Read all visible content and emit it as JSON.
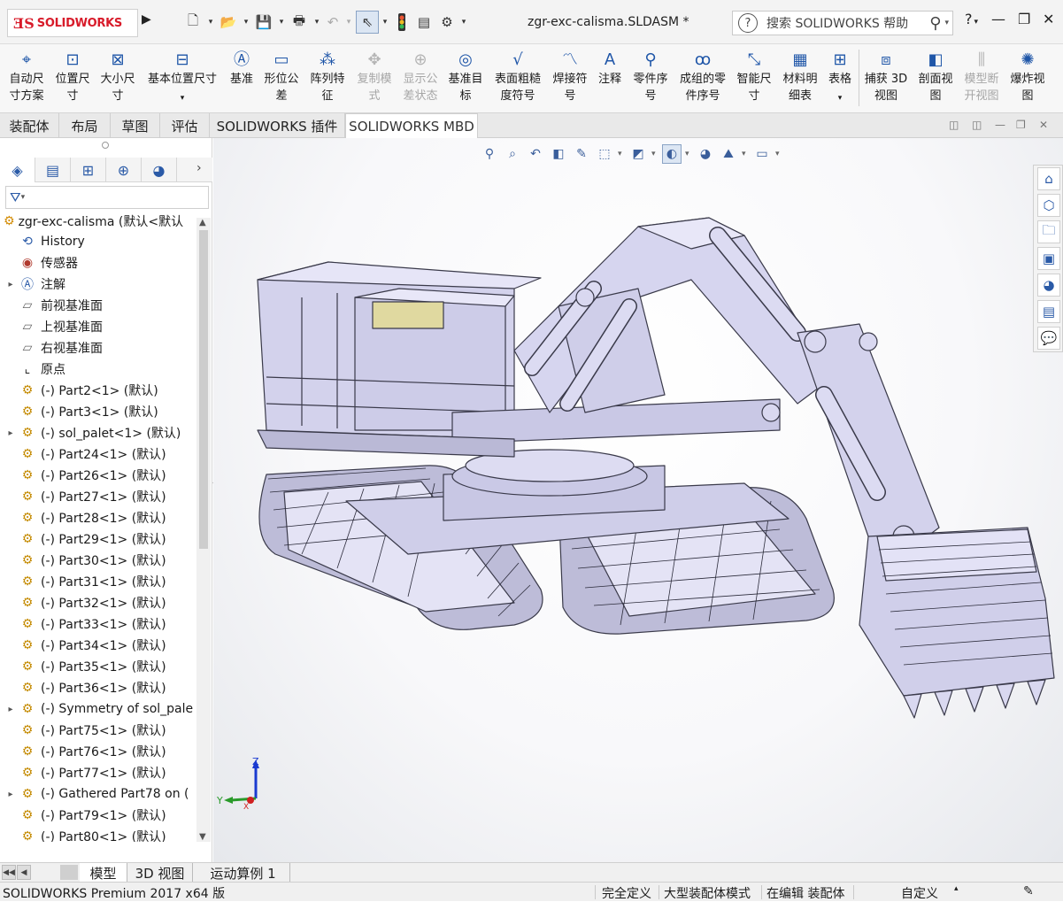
{
  "app": {
    "logo": "SOLIDWORKS",
    "doc_title": "zgr-exc-calisma.SLDASM *",
    "search_placeholder": "搜索 SOLIDWORKS 帮助",
    "help_label": "?",
    "window_buttons": [
      "—",
      "❐",
      "✕"
    ]
  },
  "quick_access": [
    "new",
    "open",
    "save",
    "print",
    "undo",
    "select",
    "rebuild",
    "file-props",
    "options"
  ],
  "ribbon": [
    {
      "l1": "自动尺",
      "l2": "寸方案",
      "icon": "auto-dim-icon",
      "disabled": false
    },
    {
      "l1": "位置尺",
      "l2": "寸",
      "icon": "location-dim-icon",
      "disabled": false
    },
    {
      "l1": "大小尺",
      "l2": "寸",
      "icon": "size-dim-icon",
      "disabled": false
    },
    {
      "l1": "基本位置尺寸",
      "l2": "",
      "icon": "basic-location-dim-icon",
      "disabled": false
    },
    {
      "l1": "基准",
      "l2": "",
      "icon": "datum-icon",
      "disabled": false
    },
    {
      "l1": "形位公",
      "l2": "差",
      "icon": "geometric-tolerance-icon",
      "disabled": false
    },
    {
      "l1": "阵列特",
      "l2": "征",
      "icon": "pattern-feature-icon",
      "disabled": false
    },
    {
      "l1": "复制模",
      "l2": "式",
      "icon": "copy-scheme-icon",
      "disabled": true
    },
    {
      "l1": "显示公",
      "l2": "差状态",
      "icon": "tolerance-status-icon",
      "disabled": true
    },
    {
      "l1": "基准目",
      "l2": "标",
      "icon": "datum-target-icon",
      "disabled": false
    },
    {
      "l1": "表面粗糙",
      "l2": "度符号",
      "icon": "surface-finish-icon",
      "disabled": false
    },
    {
      "l1": "焊接符",
      "l2": "号",
      "icon": "weld-symbol-icon",
      "disabled": false
    },
    {
      "l1": "注释",
      "l2": "",
      "icon": "note-icon",
      "disabled": false
    },
    {
      "l1": "零件序",
      "l2": "号",
      "icon": "balloon-icon",
      "disabled": false
    },
    {
      "l1": "成组的零",
      "l2": "件序号",
      "icon": "stacked-balloon-icon",
      "disabled": false
    },
    {
      "l1": "智能尺",
      "l2": "寸",
      "icon": "smart-dim-icon",
      "disabled": false
    },
    {
      "l1": "材料明",
      "l2": "细表",
      "icon": "bom-icon",
      "disabled": false
    },
    {
      "l1": "表格",
      "l2": "",
      "icon": "table-icon",
      "disabled": false
    },
    {
      "l1": "捕获 3D",
      "l2": "视图",
      "icon": "capture-3d-view-icon",
      "disabled": false
    },
    {
      "l1": "剖面视",
      "l2": "图",
      "icon": "section-view-icon",
      "disabled": false
    },
    {
      "l1": "模型断",
      "l2": "开视图",
      "icon": "model-break-icon",
      "disabled": true
    },
    {
      "l1": "爆炸视",
      "l2": "图",
      "icon": "exploded-view-icon",
      "disabled": false
    }
  ],
  "tabs": [
    "装配体",
    "布局",
    "草图",
    "评估",
    "SOLIDWORKS 插件",
    "SOLIDWORKS MBD"
  ],
  "active_tab": "SOLIDWORKS MBD",
  "tree": {
    "root": "zgr-exc-calisma  (默认<默认",
    "items": [
      {
        "label": "History",
        "icon": "history",
        "exp": ""
      },
      {
        "label": "传感器",
        "icon": "sensor",
        "exp": ""
      },
      {
        "label": "注解",
        "icon": "annotation",
        "exp": "▸"
      },
      {
        "label": "前视基准面",
        "icon": "plane",
        "exp": ""
      },
      {
        "label": "上视基准面",
        "icon": "plane",
        "exp": ""
      },
      {
        "label": "右视基准面",
        "icon": "plane",
        "exp": ""
      },
      {
        "label": "原点",
        "icon": "origin",
        "exp": ""
      },
      {
        "label": "(-) Part2<1> (默认)",
        "icon": "part",
        "exp": ""
      },
      {
        "label": "(-) Part3<1> (默认)",
        "icon": "part",
        "exp": ""
      },
      {
        "label": "(-) sol_palet<1> (默认)",
        "icon": "part",
        "exp": "▸"
      },
      {
        "label": "(-) Part24<1> (默认)",
        "icon": "part",
        "exp": ""
      },
      {
        "label": "(-) Part26<1> (默认)",
        "icon": "part",
        "exp": ""
      },
      {
        "label": "(-) Part27<1> (默认)",
        "icon": "part",
        "exp": ""
      },
      {
        "label": "(-) Part28<1> (默认)",
        "icon": "part",
        "exp": ""
      },
      {
        "label": "(-) Part29<1> (默认)",
        "icon": "part",
        "exp": ""
      },
      {
        "label": "(-) Part30<1> (默认)",
        "icon": "part",
        "exp": ""
      },
      {
        "label": "(-) Part31<1> (默认)",
        "icon": "part",
        "exp": ""
      },
      {
        "label": "(-) Part32<1> (默认)",
        "icon": "part",
        "exp": ""
      },
      {
        "label": "(-) Part33<1> (默认)",
        "icon": "part",
        "exp": ""
      },
      {
        "label": "(-) Part34<1> (默认)",
        "icon": "part",
        "exp": ""
      },
      {
        "label": "(-) Part35<1> (默认)",
        "icon": "part",
        "exp": ""
      },
      {
        "label": "(-) Part36<1> (默认)",
        "icon": "part",
        "exp": ""
      },
      {
        "label": "(-) Symmetry of sol_pale",
        "icon": "part",
        "exp": "▸"
      },
      {
        "label": "(-) Part75<1> (默认)",
        "icon": "part",
        "exp": ""
      },
      {
        "label": "(-) Part76<1> (默认)",
        "icon": "part",
        "exp": ""
      },
      {
        "label": "(-) Part77<1> (默认)",
        "icon": "part",
        "exp": ""
      },
      {
        "label": "(-) Gathered Part78 on (",
        "icon": "part",
        "exp": "▸"
      },
      {
        "label": "(-) Part79<1> (默认)",
        "icon": "part",
        "exp": ""
      },
      {
        "label": "(-) Part80<1> (默认)",
        "icon": "part",
        "exp": ""
      }
    ]
  },
  "bottom_tabs": [
    "模型",
    "3D 视图",
    "运动算例 1"
  ],
  "active_bottom_tab": "模型",
  "status": {
    "product": "SOLIDWORKS Premium 2017 x64 版",
    "defined": "完全定义",
    "mode": "大型装配体模式",
    "editing": "在编辑 装配体",
    "custom": "自定义"
  },
  "triad": {
    "z": "Z",
    "y": "Y",
    "x": "X"
  },
  "colors": {
    "accent": "#1f56a8",
    "model_fill": "#d9d8f0",
    "model_stroke": "#3a3a4a",
    "logo_red": "#d81b2a"
  }
}
